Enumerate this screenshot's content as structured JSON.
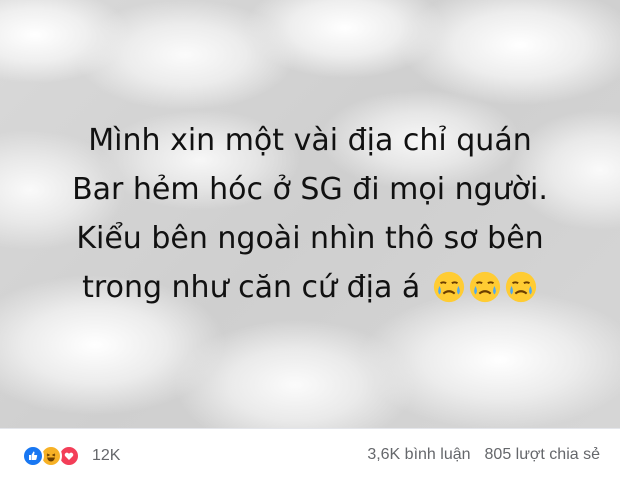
{
  "post": {
    "lines": [
      "Mình xin một vài địa chỉ quán",
      "Bar hẻm hóc ở SG đi mọi người.",
      "Kiểu bên ngoài nhìn thô sơ bên",
      "trong như căn cứ địa á"
    ],
    "emoji": [
      "crying-face-icon",
      "crying-face-icon",
      "crying-face-icon"
    ]
  },
  "reactions": {
    "icons": [
      "like-icon",
      "haha-icon",
      "love-icon"
    ],
    "colors": {
      "like": "#1877f2",
      "haha": "#f7b125",
      "love": "#f33e58"
    },
    "count": "12K"
  },
  "stats": {
    "comments": "3,6K bình luận",
    "shares": "805 lượt chia sẻ"
  }
}
